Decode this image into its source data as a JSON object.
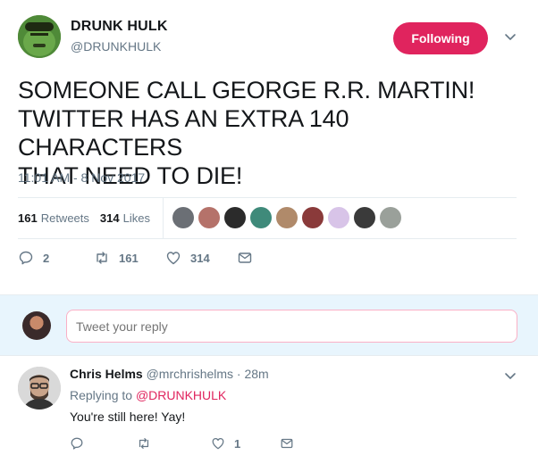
{
  "tweet": {
    "author_name": "DRUNK HULK",
    "author_handle": "@DRUNKHULK",
    "follow_label": "Following",
    "text_line1": "SOMEONE CALL GEORGE R.R. MARTIN!",
    "text_line2": "TWITTER HAS AN EXTRA 140 CHARACTERS",
    "text_line3": "THAT NEED TO DIE!",
    "timestamp": "11:01 AM - 8 Nov 2017",
    "retweets_count": "161",
    "retweets_label": "Retweets",
    "likes_count": "314",
    "likes_label": "Likes",
    "accent_color": "#e0245e",
    "likers": [
      {
        "color": "#6b6f75"
      },
      {
        "color": "#b5726a"
      },
      {
        "color": "#2b2b2b"
      },
      {
        "color": "#3f8a7a"
      },
      {
        "color": "#b08a6a"
      },
      {
        "color": "#8a3a3a"
      },
      {
        "color": "#d8c4e8"
      },
      {
        "color": "#3a3a3a"
      },
      {
        "color": "#9aa09a"
      }
    ]
  },
  "actions": {
    "reply_count": "2",
    "retweet_count": "161",
    "like_count": "314"
  },
  "reply_composer": {
    "placeholder": "Tweet your reply"
  },
  "reply": {
    "name": "Chris Helms",
    "handle_time": "@mrchrishelms · 28m",
    "replying_to_label": "Replying to",
    "replying_to_handle": "@DRUNKHULK",
    "text": "You're still here! Yay!",
    "like_count": "1"
  }
}
